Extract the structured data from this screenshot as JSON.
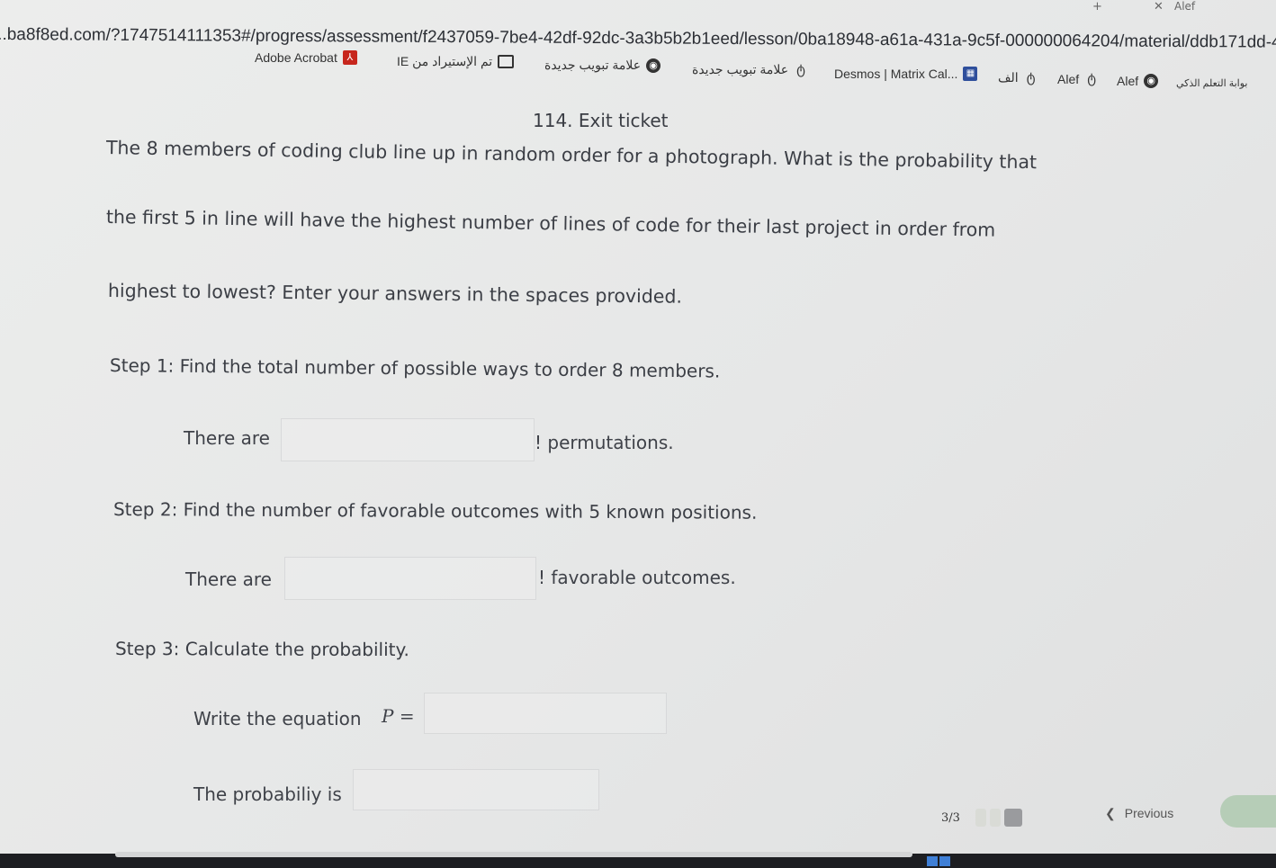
{
  "browser": {
    "url": "...ba8f8ed.com/?1747514111353#/progress/assessment/f2437059-7be4-42df-92dc-3a3b5b2b1eed/lesson/0ba18948-a61a-431a-9c5f-000000064204/material/ddb171dd-4493-4b4...",
    "tab_name": "Alef",
    "bookmarks": [
      {
        "label": "Adobe Acrobat",
        "icon": "acrobat-icon"
      },
      {
        "label": "IE تم الإستيراد من",
        "icon": "folder-icon"
      },
      {
        "label": "علامة تبويب جديدة",
        "icon": "globe-icon"
      },
      {
        "label": "علامة تبويب جديدة",
        "icon": "hand-icon"
      },
      {
        "label": "Desmos | Matrix Cal...",
        "icon": "desmos-icon"
      },
      {
        "label": "الف",
        "icon": "hand-icon"
      },
      {
        "label": "Alef",
        "icon": "hand-icon"
      },
      {
        "label": "Alef",
        "icon": "globe-icon"
      },
      {
        "label": "بوابة التعلم الذكي",
        "icon": ""
      }
    ]
  },
  "lesson": {
    "title": "114. Exit ticket",
    "question_lines": [
      "The 8 members of coding club line up in random order for a photograph. What is the probability that",
      "the first 5 in line will have the highest number of lines of code for their last project in order from",
      "highest to lowest? Enter your answers in the spaces provided."
    ],
    "step1": {
      "text": "Step 1: Find the total number of possible ways to order 8 members.",
      "prefix": "There are",
      "suffix": "! permutations.",
      "value": ""
    },
    "step2": {
      "text": "Step 2: Find the number of favorable outcomes with 5 known positions.",
      "prefix": "There are",
      "suffix": "! favorable outcomes.",
      "value": ""
    },
    "step3": {
      "text": "Step 3: Calculate the probability.",
      "equation_prefix": "Write the equation",
      "equation_symbol": "P =",
      "equation_value": "",
      "probability_prefix": "The probabiliy is",
      "probability_value": ""
    }
  },
  "footer": {
    "page_indicator": "3/3",
    "previous_label": "Previous"
  },
  "colors": {
    "accent_next": "#b6cdb7",
    "active_dot": "#9a9b9e"
  }
}
